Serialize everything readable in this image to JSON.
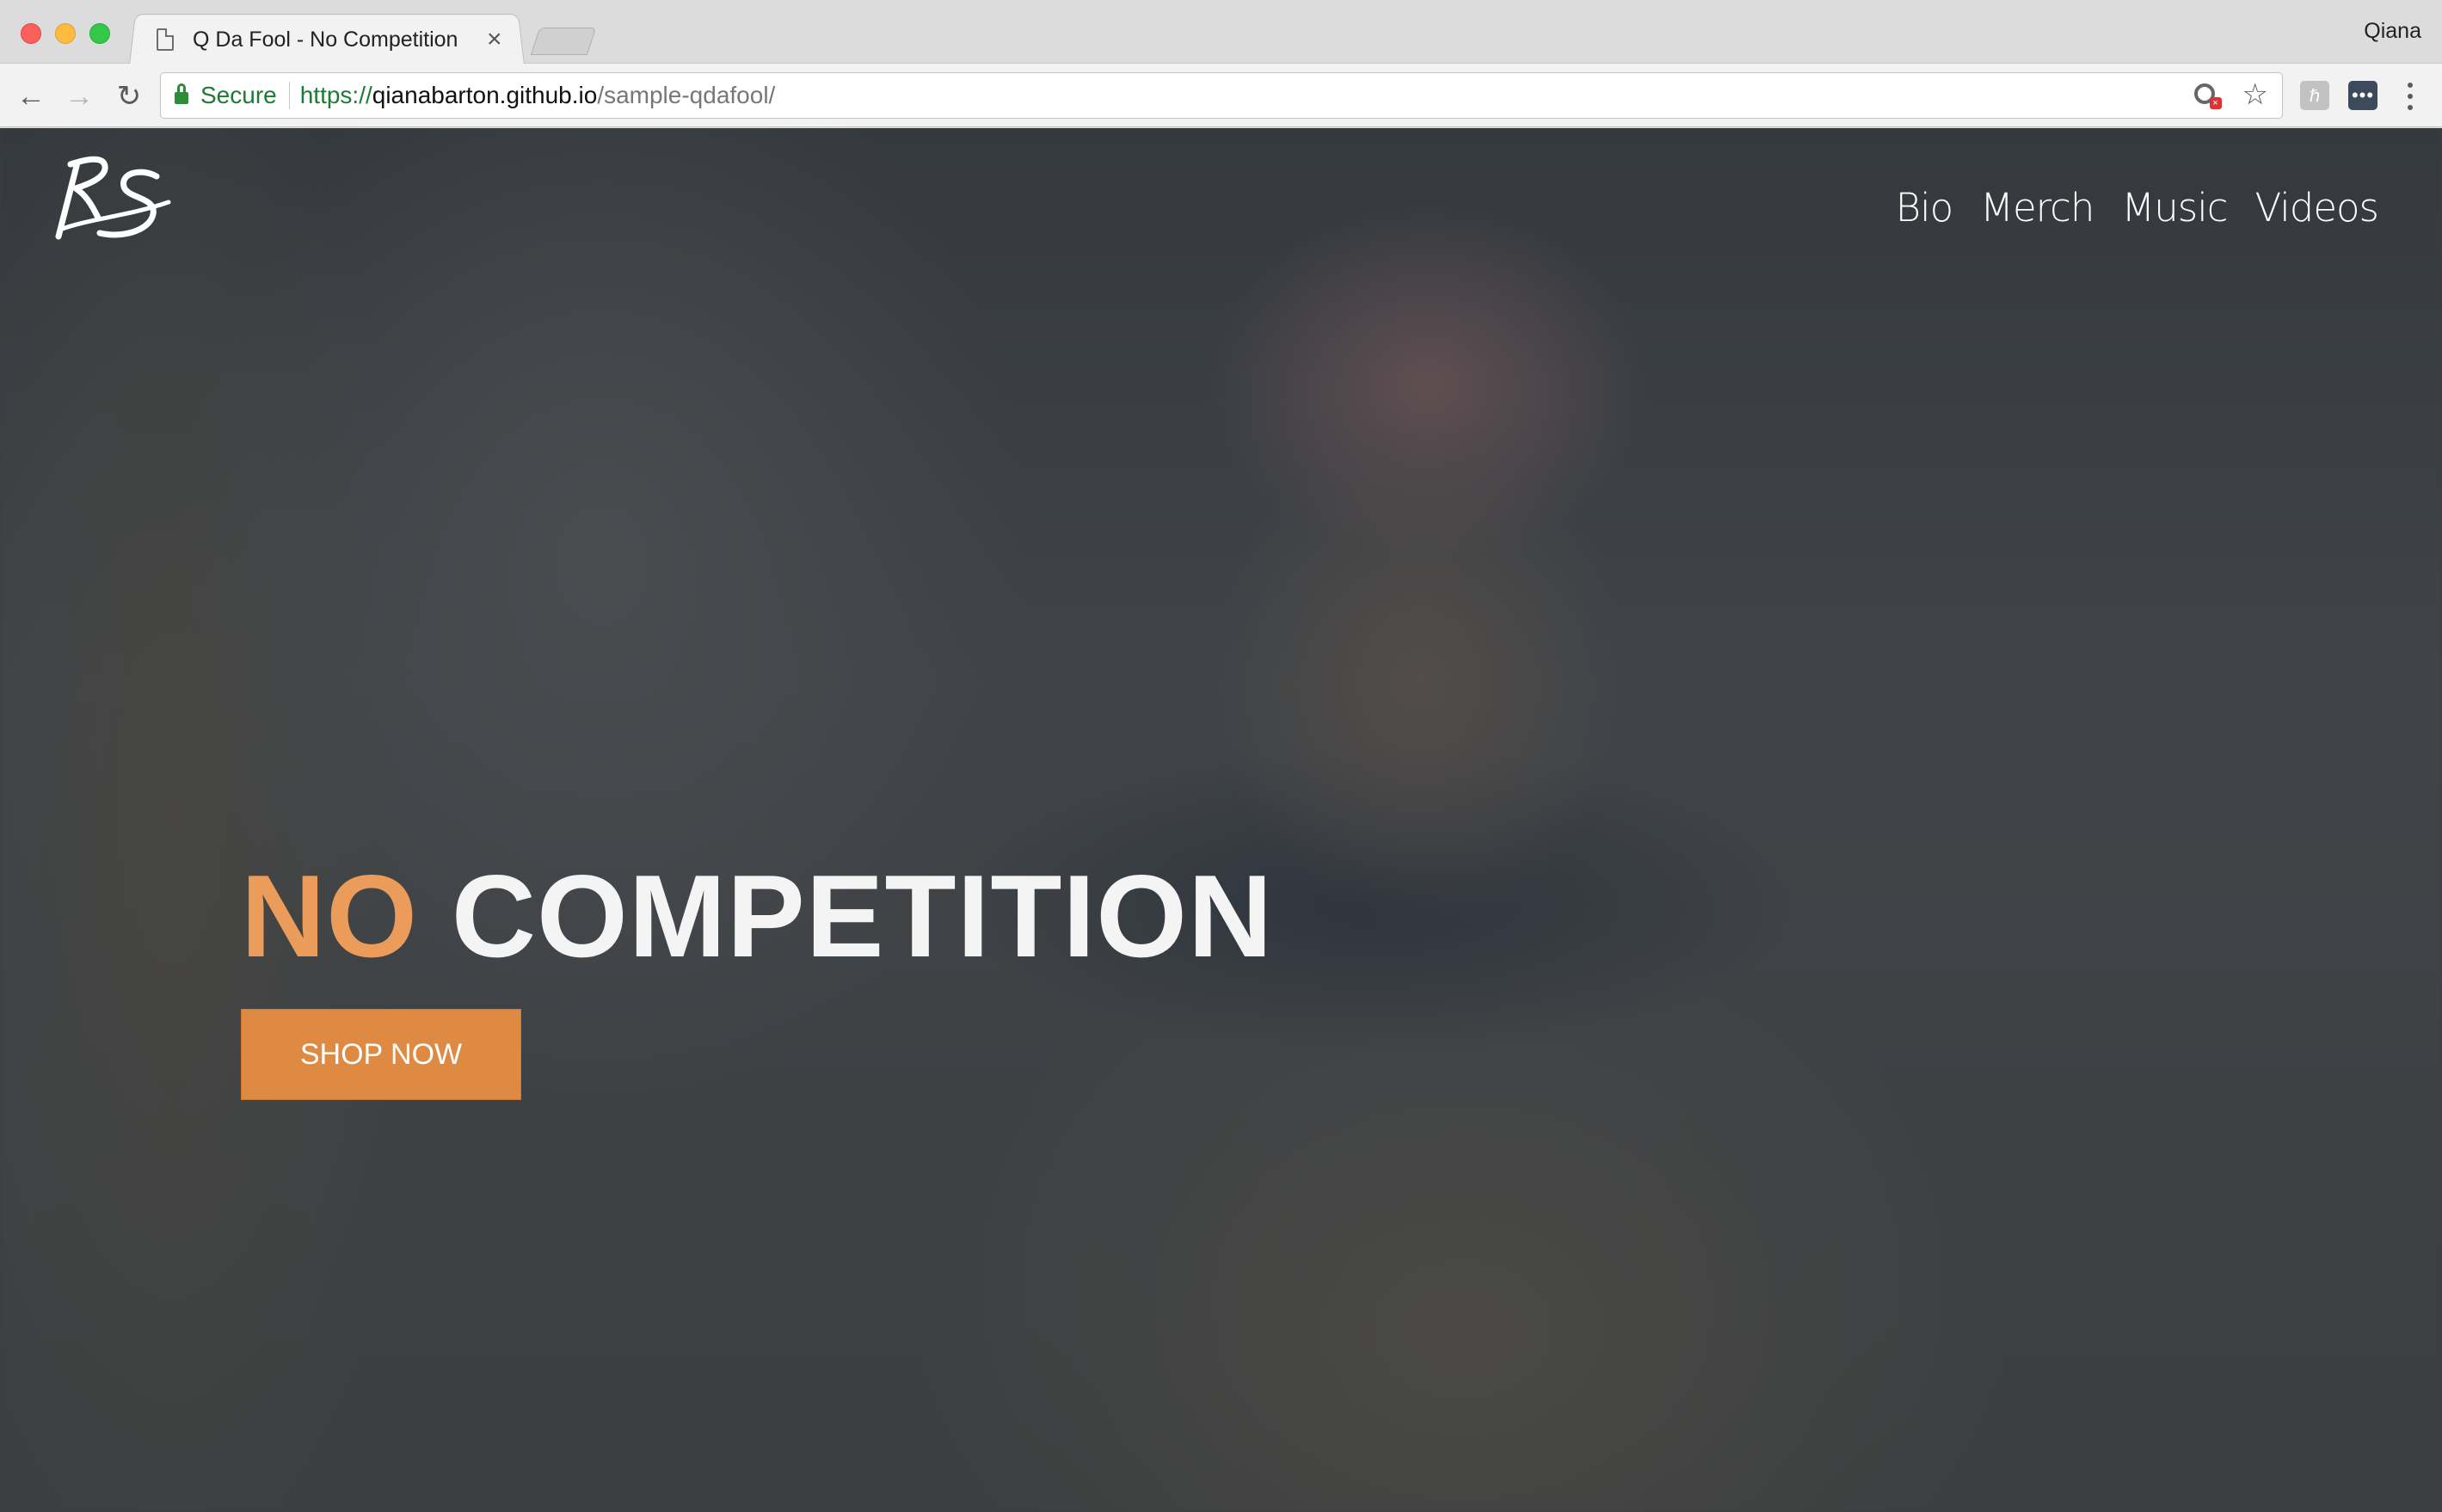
{
  "browser": {
    "tab": {
      "title": "Q Da Fool - No Competition",
      "close_glyph": "×"
    },
    "profile_name": "Qiana",
    "toolbar": {
      "back_glyph": "←",
      "forward_glyph": "→",
      "reload_glyph": "↻"
    },
    "omnibox": {
      "secure_label": "Secure",
      "url_scheme": "https://",
      "url_host": "qianabarton.github.io",
      "url_path": "/sample-qdafool/",
      "star_glyph": "☆"
    },
    "extensions": [
      {
        "icon": "extension-icon",
        "glyph": "ℏ"
      },
      {
        "icon": "password-manager-icon",
        "glyph": "•••"
      }
    ]
  },
  "site": {
    "logo_text": "RS",
    "nav": [
      {
        "label": "Bio"
      },
      {
        "label": "Merch"
      },
      {
        "label": "Music"
      },
      {
        "label": "Videos"
      }
    ],
    "hero": {
      "title_accent": "NO",
      "title_rest": "COMPETITION",
      "cta_label": "SHOP NOW"
    }
  },
  "colors": {
    "accent": "#eb9c5a",
    "button": "#df8a43",
    "secure_green": "#1e7b34"
  }
}
